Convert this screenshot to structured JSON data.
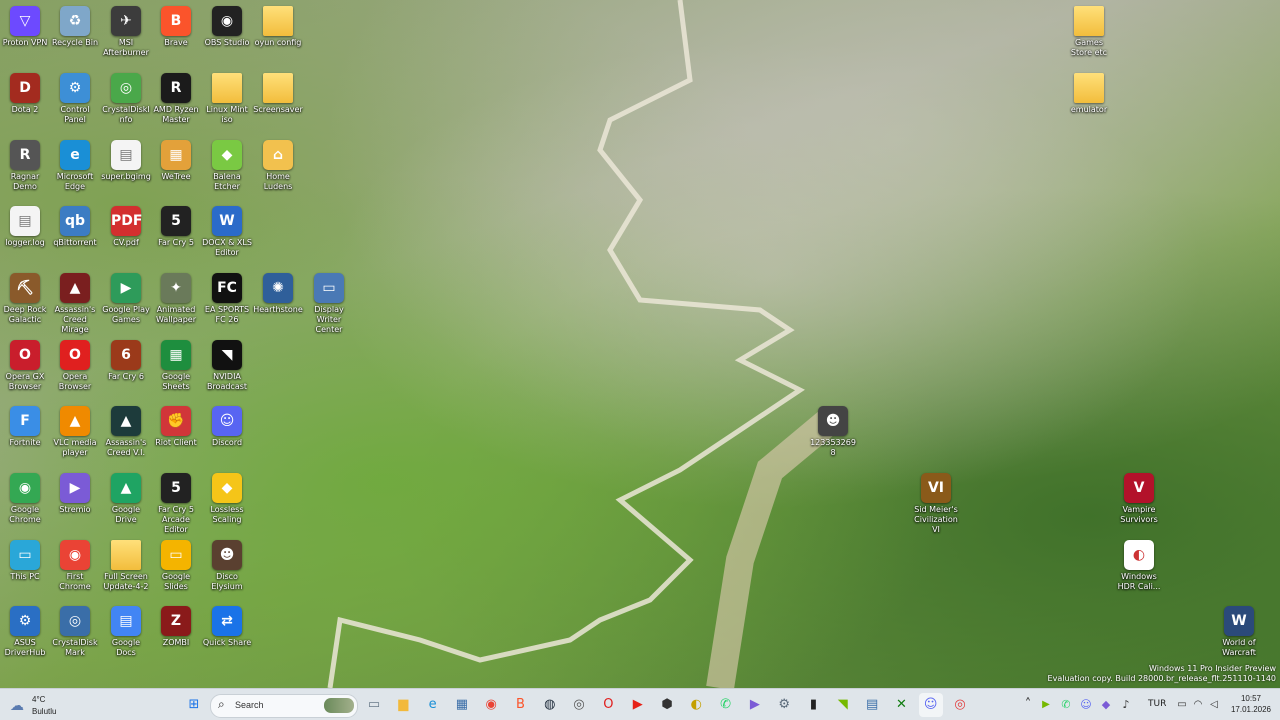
{
  "desktop_icons": [
    {
      "label": "Proton VPN",
      "glyph": "▽",
      "color": "#6d4aff"
    },
    {
      "label": "Recycle Bin",
      "glyph": "♻",
      "color": "#7fa7c9"
    },
    {
      "label": "MSI Afterburner",
      "glyph": "✈",
      "color": "#3c3c3c"
    },
    {
      "label": "Brave",
      "glyph": "B",
      "color": "#fb542b"
    },
    {
      "label": "OBS Studio",
      "glyph": "◉",
      "color": "#222"
    },
    {
      "label": "oyun config",
      "glyph": "",
      "color": "folder"
    },
    {
      "label": "Dota 2",
      "glyph": "D",
      "color": "#a32b1f"
    },
    {
      "label": "Control Panel",
      "glyph": "⚙",
      "color": "#3d8fd6"
    },
    {
      "label": "CrystalDiskInfo",
      "glyph": "◎",
      "color": "#4aa84a"
    },
    {
      "label": "AMD Ryzen Master",
      "glyph": "R",
      "color": "#1b1b1b"
    },
    {
      "label": "Linux Mint iso",
      "glyph": "",
      "color": "folder"
    },
    {
      "label": "Screensaver",
      "glyph": "",
      "color": "folder"
    },
    {
      "label": "Ragnar Demo",
      "glyph": "R",
      "color": "#555"
    },
    {
      "label": "Microsoft Edge",
      "glyph": "e",
      "color": "#1a8fd6"
    },
    {
      "label": "super.bgimg",
      "glyph": "▤",
      "color": "doc"
    },
    {
      "label": "WeTree",
      "glyph": "▦",
      "color": "#e3a13a"
    },
    {
      "label": "Balena Etcher",
      "glyph": "◆",
      "color": "#7ac943"
    },
    {
      "label": "Home Ludens",
      "glyph": "⌂",
      "color": "#f2c14e"
    },
    {
      "label": "logger.log",
      "glyph": "▤",
      "color": "doc"
    },
    {
      "label": "qBittorrent",
      "glyph": "qb",
      "color": "#3c7cc3"
    },
    {
      "label": "CV.pdf",
      "glyph": "PDF",
      "color": "#d32f2f"
    },
    {
      "label": "Far Cry 5",
      "glyph": "5",
      "color": "#222"
    },
    {
      "label": "DOCX & XLS Editor",
      "glyph": "W",
      "color": "#2b6bc9"
    },
    {
      "label": "Deep Rock Galactic",
      "glyph": "⛏",
      "color": "#8a5a2b"
    },
    {
      "label": "Assassin's Creed Mirage",
      "glyph": "▲",
      "color": "#7a1f1f"
    },
    {
      "label": "Google Play Games",
      "glyph": "▶",
      "color": "#2e9b5a"
    },
    {
      "label": "Animated Wallpaper",
      "glyph": "✦",
      "color": "#6a7a5a"
    },
    {
      "label": "EA SPORTS FC 26",
      "glyph": "FC",
      "color": "#111"
    },
    {
      "label": "Hearthstone",
      "glyph": "✺",
      "color": "#2f5f9a"
    },
    {
      "label": "Display Writer Center",
      "glyph": "▭",
      "color": "#4a79b5"
    },
    {
      "label": "Opera GX Browser",
      "glyph": "O",
      "color": "#c91e2c"
    },
    {
      "label": "Opera Browser",
      "glyph": "O",
      "color": "#e0201f"
    },
    {
      "label": "Far Cry 6",
      "glyph": "6",
      "color": "#9b3a1a"
    },
    {
      "label": "Google Sheets",
      "glyph": "▦",
      "color": "#1e8e3e"
    },
    {
      "label": "NVIDIA Broadcast",
      "glyph": "◥",
      "color": "#111"
    },
    {
      "label": "Fortnite",
      "glyph": "F",
      "color": "#3a8ee6"
    },
    {
      "label": "VLC media player",
      "glyph": "▲",
      "color": "#f08a00"
    },
    {
      "label": "Assassin's Creed V.I.",
      "glyph": "▲",
      "color": "#1d3b3b"
    },
    {
      "label": "Riot Client",
      "glyph": "✊",
      "color": "#d13639"
    },
    {
      "label": "Discord",
      "glyph": "☺",
      "color": "#5865f2"
    },
    {
      "label": "Google Chrome",
      "glyph": "◉",
      "color": "#34a853"
    },
    {
      "label": "Stremio",
      "glyph": "▶",
      "color": "#7b5bd6"
    },
    {
      "label": "Google Drive",
      "glyph": "▲",
      "color": "#1fa463"
    },
    {
      "label": "Far Cry 5 Arcade Editor",
      "glyph": "5",
      "color": "#222"
    },
    {
      "label": "Lossless Scaling",
      "glyph": "◆",
      "color": "#f5c518"
    },
    {
      "label": "This PC",
      "glyph": "▭",
      "color": "#2aa7d8"
    },
    {
      "label": "First Chrome",
      "glyph": "◉",
      "color": "#ea4335"
    },
    {
      "label": "Full Screen Update-4-2",
      "glyph": "",
      "color": "folder"
    },
    {
      "label": "Google Slides",
      "glyph": "▭",
      "color": "#f4b400"
    },
    {
      "label": "Disco Elysium",
      "glyph": "☻",
      "color": "#5a4030"
    },
    {
      "label": "ASUS DriverHub",
      "glyph": "⚙",
      "color": "#2a6fc4"
    },
    {
      "label": "CrystalDiskMark",
      "glyph": "◎",
      "color": "#3a6ea8"
    },
    {
      "label": "Google Docs",
      "glyph": "▤",
      "color": "#4285f4"
    },
    {
      "label": "ZOMBI",
      "glyph": "Z",
      "color": "#8a1a1a"
    },
    {
      "label": "Quick Share",
      "glyph": "⇄",
      "color": "#1a73e8"
    },
    {
      "label": "Games Store etc",
      "glyph": "",
      "color": "folder"
    },
    {
      "label": "emulator",
      "glyph": "",
      "color": "folder"
    },
    {
      "label": "1233532698",
      "glyph": "☻",
      "color": "#444"
    },
    {
      "label": "Sid Meier's Civilization VI",
      "glyph": "VI",
      "color": "#8a5a1a"
    },
    {
      "label": "Vampire Survivors",
      "glyph": "V",
      "color": "#b3122a"
    },
    {
      "label": "Windows HDR Cali...",
      "glyph": "◐",
      "color": "#ffffff"
    },
    {
      "label": "World of Warcraft",
      "glyph": "W",
      "color": "#2b4a7a"
    }
  ],
  "watermark": {
    "line1": "Windows 11 Pro Insider Preview",
    "line2": "Evaluation copy. Build 28000.br_release_flt.251110-1140"
  },
  "taskbar": {
    "weather": {
      "temp": "4°C",
      "condition": "Bulutlu",
      "icon": "cloud-icon"
    },
    "search_placeholder": "Search",
    "pinned": [
      {
        "name": "file-explorer-icon",
        "glyph": "▭",
        "color": "#6a7a8a"
      },
      {
        "name": "folder-icon",
        "glyph": "▆",
        "color": "#f2b93b"
      },
      {
        "name": "edge-icon",
        "glyph": "e",
        "color": "#1a8fd6"
      },
      {
        "name": "store-icon",
        "glyph": "▦",
        "color": "#3a6ea8"
      },
      {
        "name": "chrome-icon",
        "glyph": "◉",
        "color": "#ea4335"
      },
      {
        "name": "brave-icon",
        "glyph": "B",
        "color": "#fb542b"
      },
      {
        "name": "steam-icon",
        "glyph": "◍",
        "color": "#1b2838"
      },
      {
        "name": "app-icon",
        "glyph": "◎",
        "color": "#555"
      },
      {
        "name": "opera-icon",
        "glyph": "O",
        "color": "#e0201f"
      },
      {
        "name": "youtube-icon",
        "glyph": "▶",
        "color": "#e62117"
      },
      {
        "name": "app2-icon",
        "glyph": "⬢",
        "color": "#333"
      },
      {
        "name": "app3-icon",
        "glyph": "◐",
        "color": "#c4a000"
      },
      {
        "name": "whatsapp-icon",
        "glyph": "✆",
        "color": "#25d366"
      },
      {
        "name": "stremio-icon",
        "glyph": "▶",
        "color": "#7b5bd6"
      },
      {
        "name": "settings-icon",
        "glyph": "⚙",
        "color": "#5a6a7a"
      },
      {
        "name": "terminal-icon",
        "glyph": "▮",
        "color": "#222"
      },
      {
        "name": "nvidia-icon",
        "glyph": "◥",
        "color": "#76b900"
      },
      {
        "name": "app4-icon",
        "glyph": "▤",
        "color": "#3a6ea8"
      },
      {
        "name": "xbox-icon",
        "glyph": "✕",
        "color": "#107c10"
      },
      {
        "name": "discord-icon",
        "glyph": "☺",
        "color": "#5865f2"
      },
      {
        "name": "app5-icon",
        "glyph": "◎",
        "color": "#e23b3b"
      }
    ],
    "tray": {
      "language": "TUR",
      "time": "10:57",
      "date": "17.01.2026"
    }
  }
}
